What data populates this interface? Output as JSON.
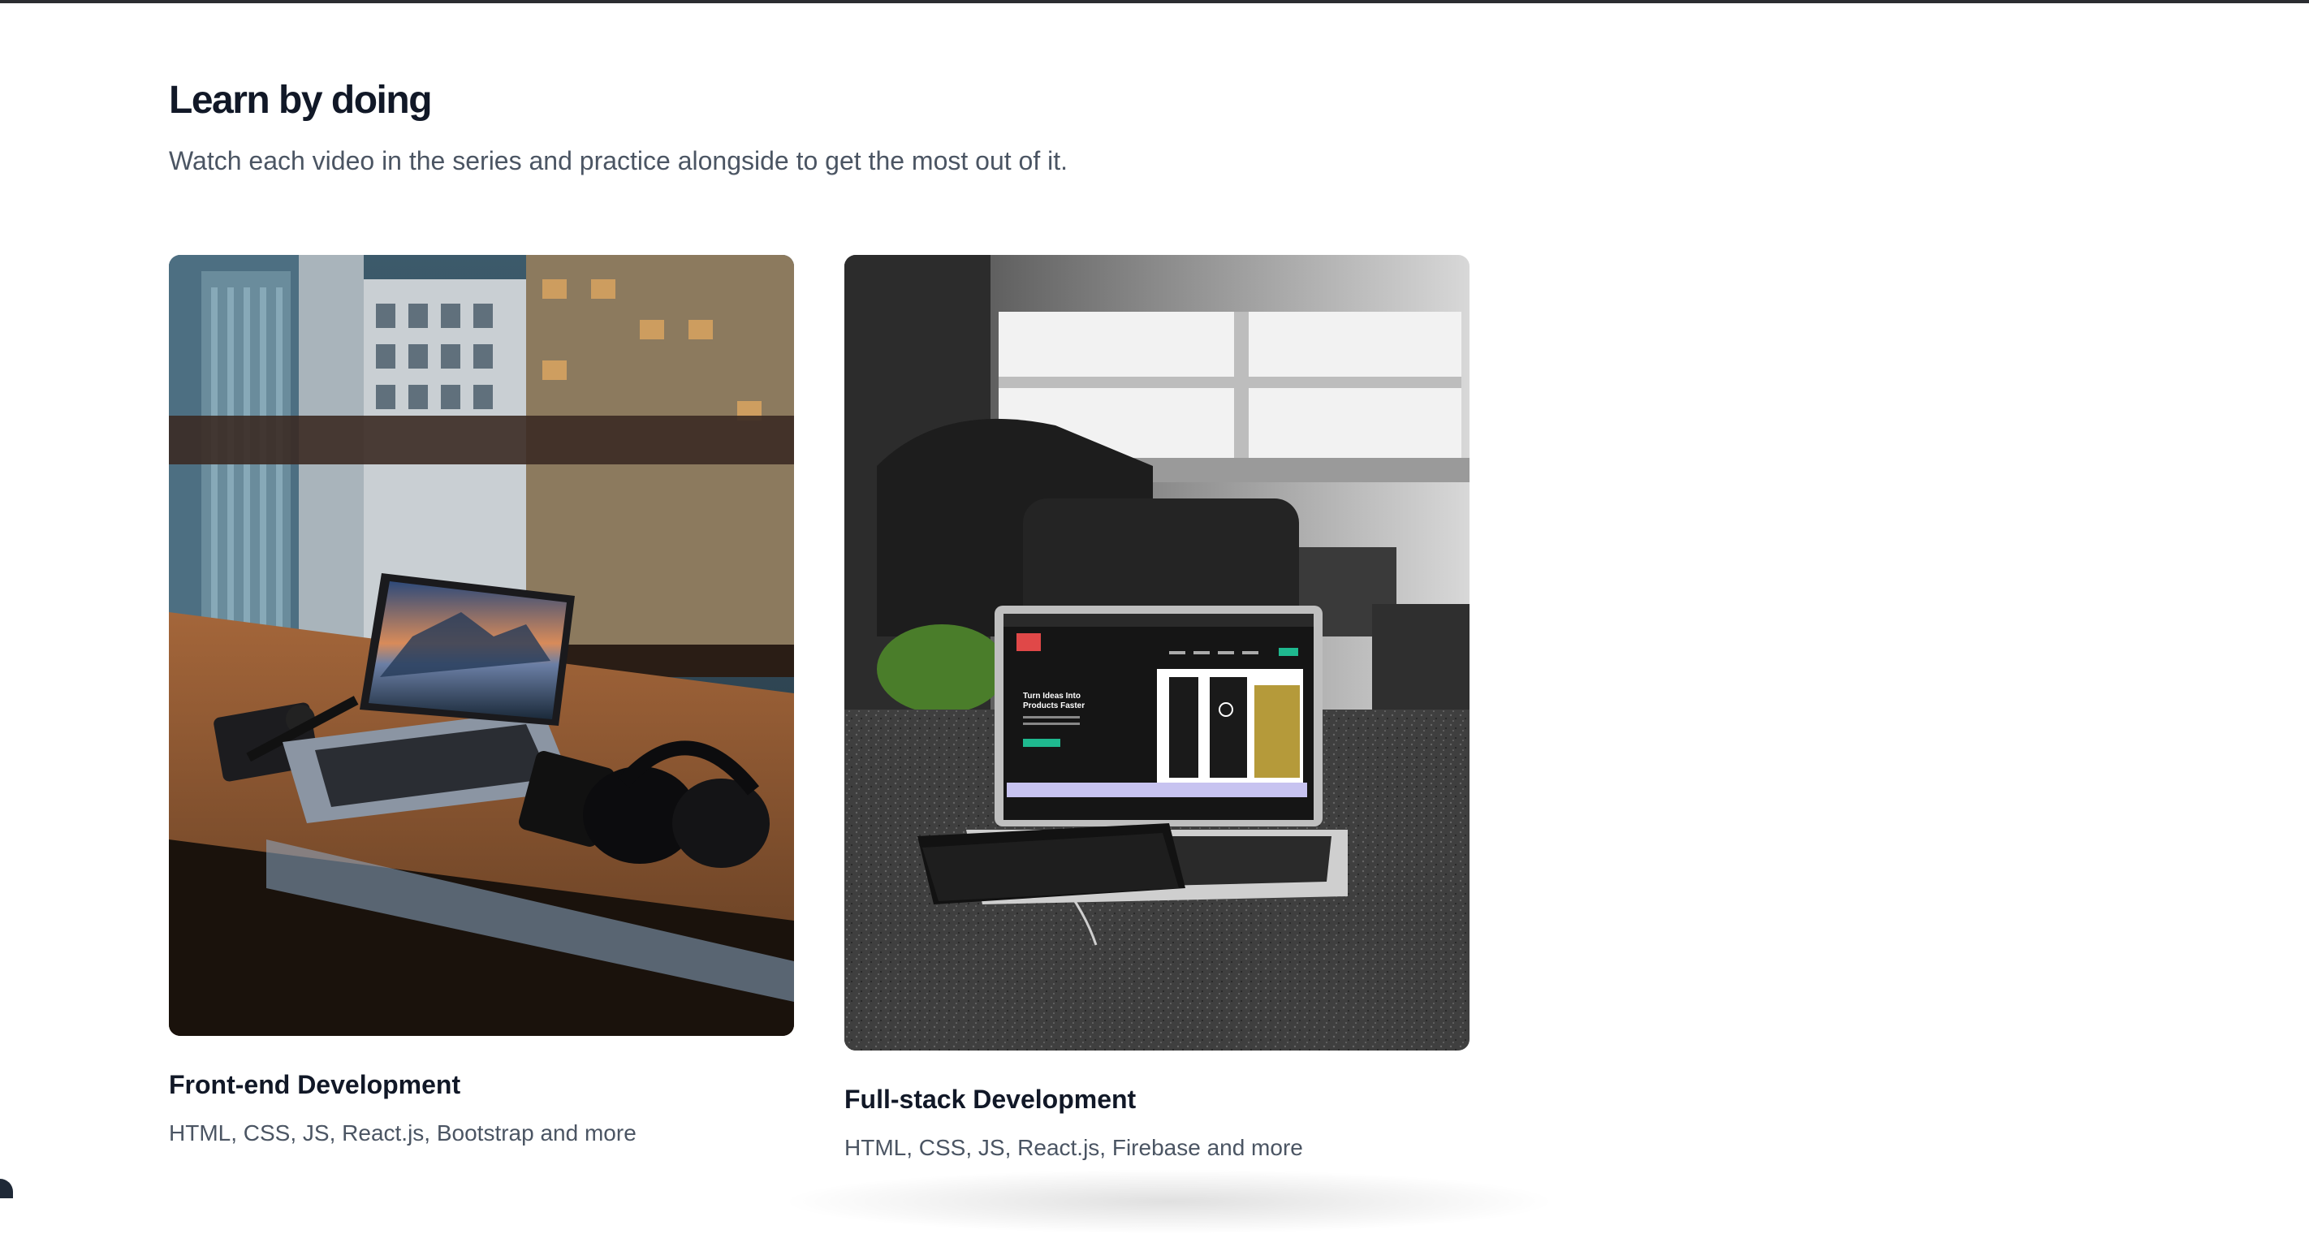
{
  "section": {
    "title": "Learn by doing",
    "subtitle": "Watch each video in the series and practice alongside to get the most out of it."
  },
  "cards": [
    {
      "title": "Front-end Development",
      "description": "HTML, CSS, JS, React.js, Bootstrap and more",
      "image_icon": "laptop-on-desk-city-view-photo"
    },
    {
      "title": "Full-stack Development",
      "description": "HTML, CSS, JS, React.js, Firebase and more",
      "image_icon": "laptop-on-table-monochrome-photo",
      "laptop_screen_text": {
        "headline": "Turn Ideas Into Products Faster"
      }
    }
  ],
  "colors": {
    "heading": "#111827",
    "body_text": "#4b5563",
    "background": "#ffffff",
    "top_border": "#2b2d31"
  }
}
